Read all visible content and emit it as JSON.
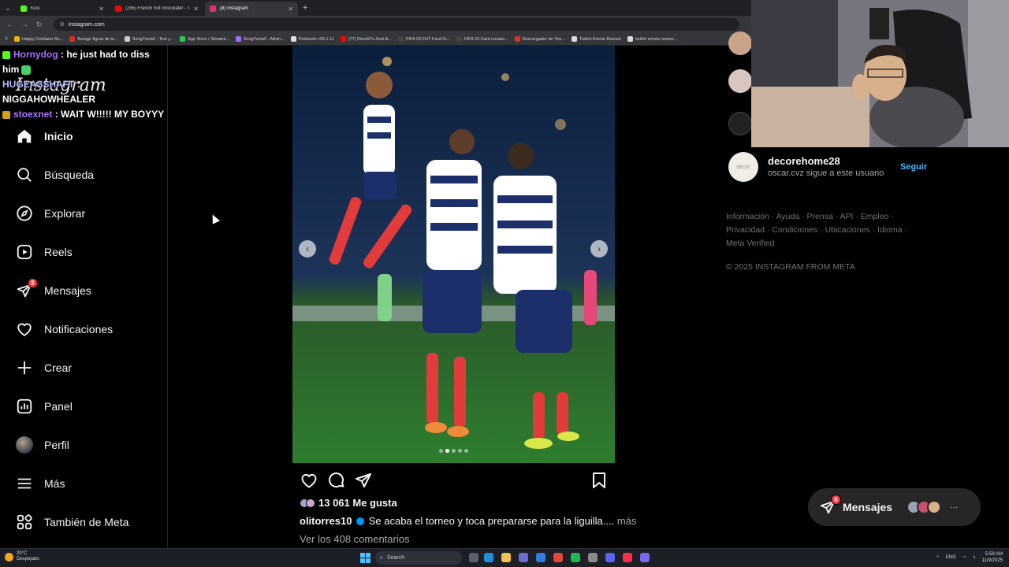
{
  "browser": {
    "tabs": [
      {
        "title": "Kick",
        "color": "#53fc18",
        "active": false
      },
      {
        "title": "(295) French hot chocolate! - Yo",
        "color": "#ff0000",
        "active": false
      },
      {
        "title": "(8) Instagram",
        "color": "#e1306c",
        "active": true
      }
    ],
    "url": "instagram.com",
    "bookmarks": [
      {
        "label": "Happy Cristiano Ro...",
        "color": "#e6b800"
      },
      {
        "label": "Burago figura de to...",
        "color": "#d93025"
      },
      {
        "label": "SongTrivia2 - Test y...",
        "color": "#cccccc"
      },
      {
        "label": "App Store / Streami...",
        "color": "#34c759"
      },
      {
        "label": "SongTrivia2 - Advin...",
        "color": "#a66cff"
      },
      {
        "label": "Peletools v25.1.11",
        "color": "#dddddd"
      },
      {
        "label": "(77) Rezo97s Zest-A...",
        "color": "#ff0000"
      },
      {
        "label": "FIFA 23 FUT Card Cr...",
        "color": "#444444"
      },
      {
        "label": "FIFA 23 Card creator...",
        "color": "#444444"
      },
      {
        "label": "Descargador de You...",
        "color": "#d93025"
      },
      {
        "label": "Twitch Emote Resizer",
        "color": "#dddddd"
      },
      {
        "label": "twitch emote resizer...",
        "color": "#dddddd"
      }
    ]
  },
  "chat": {
    "lines": [
      {
        "user": "Hornydog",
        "text": ": he just had to diss him"
      },
      {
        "user": "HUGEASSHAFT",
        "text": ": NIGGAHOWHEALER"
      },
      {
        "user": "stoexnet",
        "text": ": WAIT W!!!!! MY BOYYY"
      }
    ]
  },
  "sidebar": {
    "logo": "Instagram",
    "items": [
      {
        "label": "Inicio",
        "icon": "home-icon"
      },
      {
        "label": "Búsqueda",
        "icon": "search-icon"
      },
      {
        "label": "Explorar",
        "icon": "compass-icon"
      },
      {
        "label": "Reels",
        "icon": "reels-icon"
      },
      {
        "label": "Mensajes",
        "icon": "messenger-icon",
        "badge": "8"
      },
      {
        "label": "Notificaciones",
        "icon": "heart-icon"
      },
      {
        "label": "Crear",
        "icon": "plus-icon"
      },
      {
        "label": "Panel",
        "icon": "dashboard-icon"
      },
      {
        "label": "Perfil",
        "icon": "avatar"
      },
      {
        "label": "Más",
        "icon": "menu-icon"
      },
      {
        "label": "También de Meta",
        "icon": "meta-apps-icon"
      }
    ]
  },
  "post": {
    "likes": "13 061 Me gusta",
    "author": "olitorres10",
    "caption": "Se acaba el torneo y toca prepararse para la liguilla....",
    "more": "más",
    "comments_link": "Ver los 408 comentarios",
    "carousel_dots": 5,
    "active_dot": 2
  },
  "right": {
    "suggestion": {
      "username": "decorehome28",
      "subtitle": "oscar.cvz sigue a este usuario",
      "follow": "Seguir",
      "avatar_text": "decor"
    },
    "footer_links": "Información · Ayuda · Prensa · API · Empleo · Privacidad · Condiciones · Ubicaciones · Idioma · Meta Verified",
    "copyright": "© 2025 INSTAGRAM FROM META"
  },
  "messages_pill": {
    "label": "Mensajes",
    "badge": "8"
  },
  "taskbar": {
    "temp": "20°C",
    "weather": "Despejado",
    "search": "Search",
    "lang": "ENG",
    "time": "5:59 AM",
    "date": "11/9/2025"
  }
}
